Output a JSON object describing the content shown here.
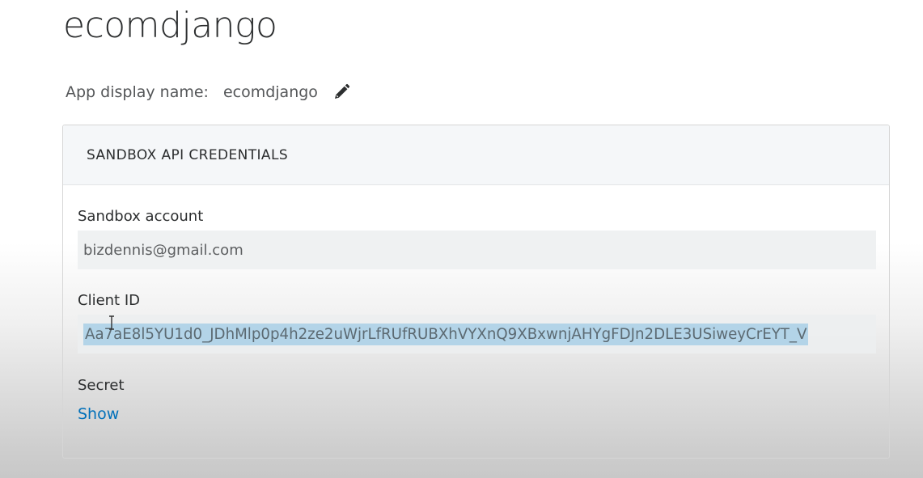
{
  "app": {
    "title": "ecomdjango",
    "display_name_label": "App display name:",
    "display_name_value": "ecomdjango"
  },
  "credentials": {
    "header": "SANDBOX API CREDENTIALS",
    "sandbox_account_label": "Sandbox account",
    "sandbox_account_value": "bizdennis@gmail.com",
    "client_id_label": "Client ID",
    "client_id_value": "Aa7aE8l5YU1d0_JDhMlp0p4h2ze2uWjrLfRUfRUBXhVYXnQ9XBxwnjAHYgFDJn2DLE3USiweyCrEYT_V",
    "secret_label": "Secret",
    "secret_show_link": "Show"
  },
  "icons": {
    "edit": "pencil-icon",
    "cursor": "text-cursor-icon"
  },
  "colors": {
    "link": "#0070ba",
    "selection": "#b3d4e8",
    "header_bg": "#f5f7f9",
    "field_bg": "#eceef0"
  }
}
